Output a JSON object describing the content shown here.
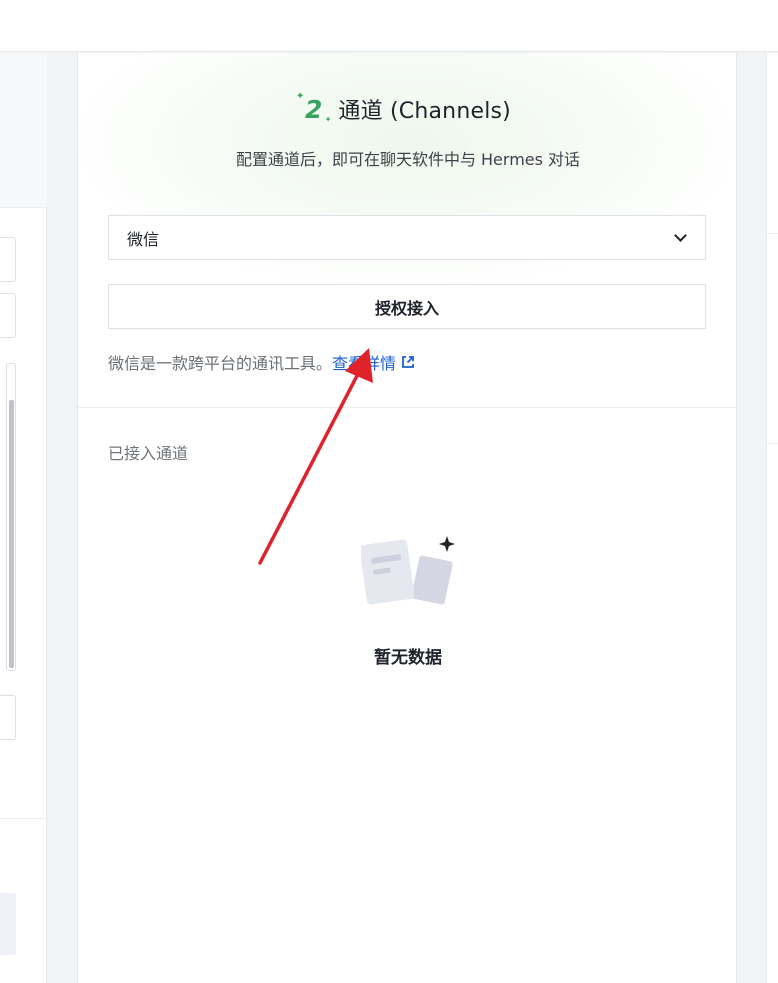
{
  "section": {
    "title": "通道 (Channels)",
    "subtitle": "配置通道后，即可在聊天软件中与 Hermes 对话"
  },
  "channel_select": {
    "selected": "微信"
  },
  "authorize_button": {
    "label": "授权接入"
  },
  "description": {
    "text": "微信是一款跨平台的通讯工具。",
    "link_label": "查看详情",
    "link_color": "#1f5fd1"
  },
  "connected": {
    "heading": "已接入通道",
    "empty_text": "暂无数据"
  },
  "icons": {
    "step": "step-2-icon",
    "dropdown": "chevron-down-icon",
    "external": "external-link-icon",
    "empty": "empty-documents-icon",
    "annotation": "red-arrow-annotation"
  },
  "colors": {
    "accent_green": "#35a55e",
    "annotation_red": "#e0222a"
  }
}
